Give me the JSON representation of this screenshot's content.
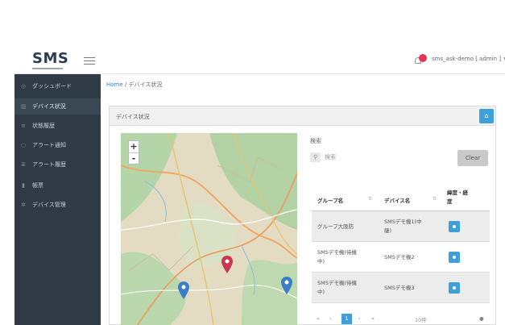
{
  "app": {
    "logo": "SMS",
    "user": "sms_ask-demo [ admin ]"
  },
  "sidebar": {
    "items": [
      {
        "icon": "dashboard-icon",
        "label": "ダッシュボード",
        "active": false
      },
      {
        "icon": "bar-chart-icon",
        "label": "デバイス状況",
        "active": true
      },
      {
        "icon": "list-icon",
        "label": "状態履歴",
        "active": false
      },
      {
        "icon": "alert-icon",
        "label": "アラート通知",
        "active": false
      },
      {
        "icon": "history-icon",
        "label": "アラート履歴",
        "active": false
      },
      {
        "icon": "chart-icon",
        "label": "帳票",
        "active": false
      },
      {
        "icon": "gear-icon",
        "label": "デバイス管理",
        "active": false
      }
    ]
  },
  "breadcrumb": {
    "home": "Home",
    "separator": "/",
    "current": "デバイス状況"
  },
  "panel": {
    "title": "デバイス状況"
  },
  "map": {
    "zoom_in": "+",
    "zoom_out": "-"
  },
  "search": {
    "label": "検索",
    "placeholder": "検索",
    "clear": "Clear"
  },
  "table": {
    "headers": {
      "group": "グループ名",
      "device": "デバイス名",
      "location_line1": "緯度・経",
      "location_line2": "度"
    },
    "rows": [
      {
        "group": "グループ大阪防",
        "device_line1": "SMSデモ機1(中",
        "device_line2": "継)"
      },
      {
        "group_line1": "SMSデモ機(待機",
        "group_line2": "中)",
        "device": "SMSデモ機2"
      },
      {
        "group_line1": "SMSデモ機(待機",
        "group_line2": "中)",
        "device": "SMSデモ機3"
      }
    ]
  },
  "pager": {
    "first": "«",
    "prev": "‹",
    "current": "1",
    "next": "›",
    "last": "»",
    "per_page": "10件"
  },
  "colors": {
    "sidebar_bg": "#2f3a45",
    "accent": "#3fa0d8",
    "marker_red": "#c8384f",
    "marker_blue": "#3a7fc6"
  }
}
